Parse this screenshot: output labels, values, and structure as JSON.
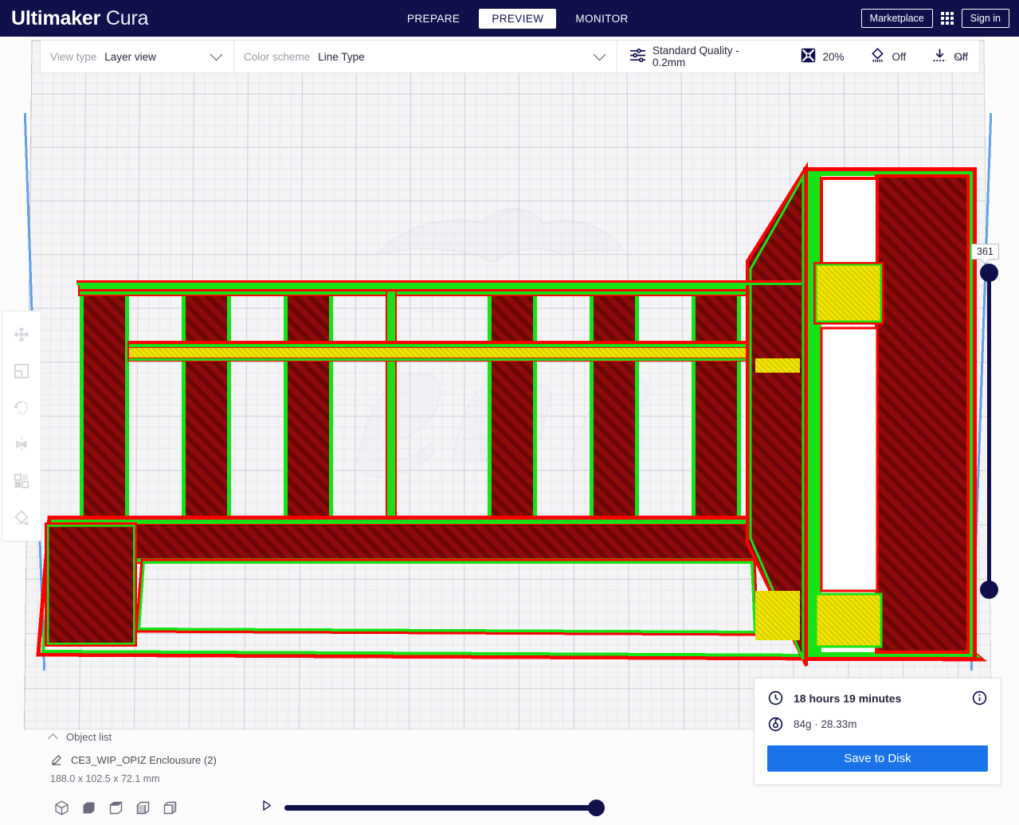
{
  "app": {
    "brand_bold": "Ultimaker",
    "brand_light": "Cura",
    "header_bg": "#10104b",
    "accent_blue": "#1a73e8"
  },
  "header": {
    "tabs": [
      {
        "label": "PREPARE",
        "active": false
      },
      {
        "label": "PREVIEW",
        "active": true
      },
      {
        "label": "MONITOR",
        "active": false
      }
    ],
    "marketplace_label": "Marketplace",
    "apps_icon": "grid-apps-icon",
    "signin_label": "Sign in"
  },
  "settings_bar": {
    "view_type_label": "View type",
    "view_type_value": "Layer view",
    "color_scheme_label": "Color scheme",
    "color_scheme_value": "Line Type",
    "quality_icon": "print-settings-sliders-icon",
    "quality_value": "Standard Quality - 0.2mm",
    "infill_icon": "infill-icon",
    "infill_value": "20%",
    "support_icon": "support-icon",
    "support_value": "Off",
    "adhesion_icon": "adhesion-icon",
    "adhesion_value": "Off"
  },
  "left_toolbar": {
    "tools": [
      {
        "name": "move-tool",
        "icon": "move-arrows-icon"
      },
      {
        "name": "scale-tool",
        "icon": "scale-icon"
      },
      {
        "name": "rotate-tool",
        "icon": "rotate-icon"
      },
      {
        "name": "mirror-tool",
        "icon": "mirror-icon"
      },
      {
        "name": "per-model-settings-tool",
        "icon": "per-model-settings-icon"
      },
      {
        "name": "support-blocker-tool",
        "icon": "support-blocker-icon"
      }
    ]
  },
  "layer_slider": {
    "value": "361",
    "max_label": "361"
  },
  "object_list": {
    "title": "Object list",
    "collapse_icon": "chevron-up-icon",
    "item_icon": "pencil-icon",
    "item_name": "CE3_WIP_OPIZ Enclousure (2)",
    "dimensions": "188.0 x 102.5 x 72.1 mm"
  },
  "bottom_bar": {
    "view_cubes": [
      {
        "name": "view-3d",
        "icon": "cube-3d-icon"
      },
      {
        "name": "view-front",
        "icon": "cube-front-icon"
      },
      {
        "name": "view-top",
        "icon": "cube-top-icon"
      },
      {
        "name": "view-left",
        "icon": "cube-left-icon"
      },
      {
        "name": "view-right",
        "icon": "cube-right-icon"
      }
    ],
    "play_icon": "play-triangle-icon",
    "sim_slider_position": "100"
  },
  "print_panel": {
    "time_icon": "clock-icon",
    "time_value": "18 hours 19 minutes",
    "material_icon": "spool-icon",
    "material_value": "84g · 28.33m",
    "info_icon": "info-circle-icon",
    "save_button": "Save to Disk"
  },
  "viewport": {
    "plate_watermark": "ender-logo-watermark",
    "line_colors": {
      "wall_outer": "#16e216",
      "wall_inner": "#ff0000",
      "skin": "#f2e500",
      "infill": "#8b0000",
      "plate_edge": "#4a90e2"
    }
  }
}
